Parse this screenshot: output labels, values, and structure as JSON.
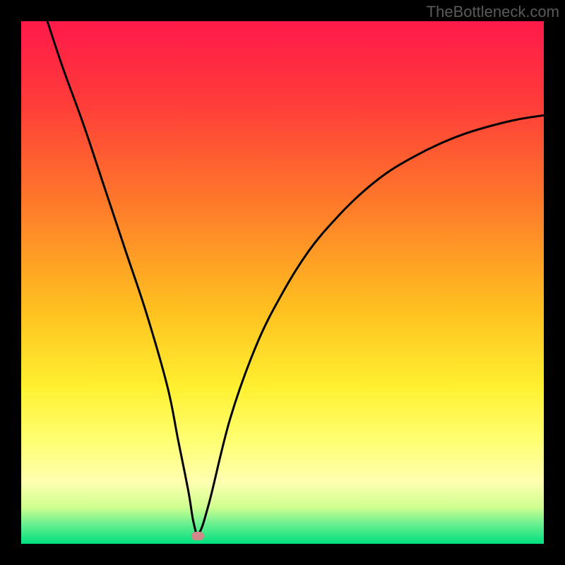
{
  "watermark": "TheBottleneck.com",
  "chart_data": {
    "type": "line",
    "title": "",
    "xlabel": "",
    "ylabel": "",
    "xlim": [
      0,
      100
    ],
    "ylim": [
      0,
      100
    ],
    "curve": {
      "x": [
        5,
        8,
        12,
        16,
        20,
        24,
        28,
        30,
        32,
        33,
        34,
        36,
        40,
        45,
        50,
        55,
        60,
        65,
        70,
        75,
        80,
        85,
        90,
        95,
        100
      ],
      "y": [
        100,
        91,
        80,
        68,
        56,
        44,
        30,
        20,
        10,
        4,
        2,
        8,
        24,
        38,
        48,
        56,
        62,
        67,
        71,
        74,
        76.5,
        78.5,
        80,
        81.2,
        82
      ]
    },
    "marker": {
      "x": 33.8,
      "y": 1.5
    },
    "gradient_stops": [
      {
        "offset": 0,
        "color": "#ff1a4a"
      },
      {
        "offset": 15,
        "color": "#ff3a3a"
      },
      {
        "offset": 35,
        "color": "#ff7a2a"
      },
      {
        "offset": 55,
        "color": "#ffc020"
      },
      {
        "offset": 70,
        "color": "#fff030"
      },
      {
        "offset": 80,
        "color": "#ffff70"
      },
      {
        "offset": 88,
        "color": "#ffffb0"
      },
      {
        "offset": 93,
        "color": "#d0ff90"
      },
      {
        "offset": 96,
        "color": "#70f090"
      },
      {
        "offset": 100,
        "color": "#00e080"
      }
    ]
  }
}
